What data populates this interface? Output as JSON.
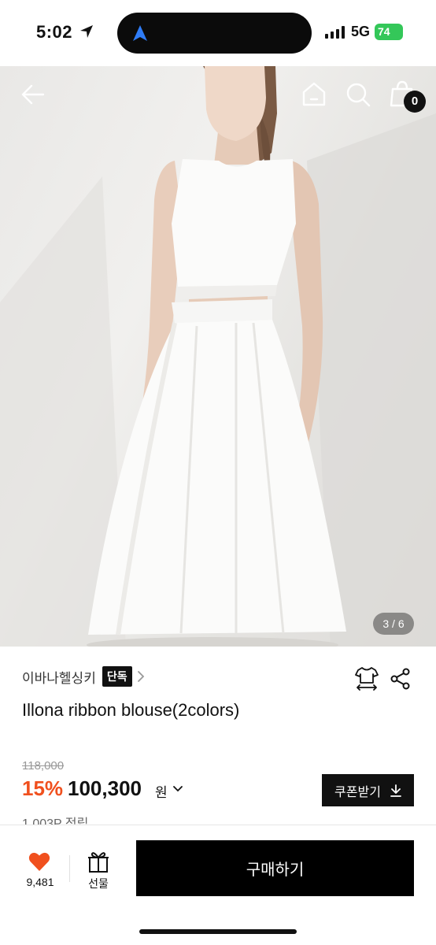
{
  "status_bar": {
    "time": "5:02",
    "network": "5G",
    "battery": "74"
  },
  "hero": {
    "page_indicator": "3 / 6",
    "cart_count": "0",
    "colors": {
      "background": "#ecebe9",
      "garment": "#fbfbfa"
    }
  },
  "product": {
    "brand": "이바나헬싱키",
    "badge": "단독",
    "title": "Illona ribbon blouse(2colors)",
    "original_price": "118,000",
    "discount": "15%",
    "price": "100,300",
    "currency": "원",
    "coupon_label": "쿠폰받기",
    "points": "1,003P 적립"
  },
  "bottom_bar": {
    "like_count": "9,481",
    "gift_label": "선물",
    "buy_label": "구매하기",
    "like_color": "#f0501e"
  },
  "icons": {
    "back": "back-arrow-icon",
    "home": "home-icon",
    "search": "search-icon",
    "cart": "shopping-bag-icon",
    "size": "size-guide-icon",
    "share": "share-icon",
    "like": "heart-icon",
    "gift": "gift-icon",
    "download": "download-icon"
  }
}
